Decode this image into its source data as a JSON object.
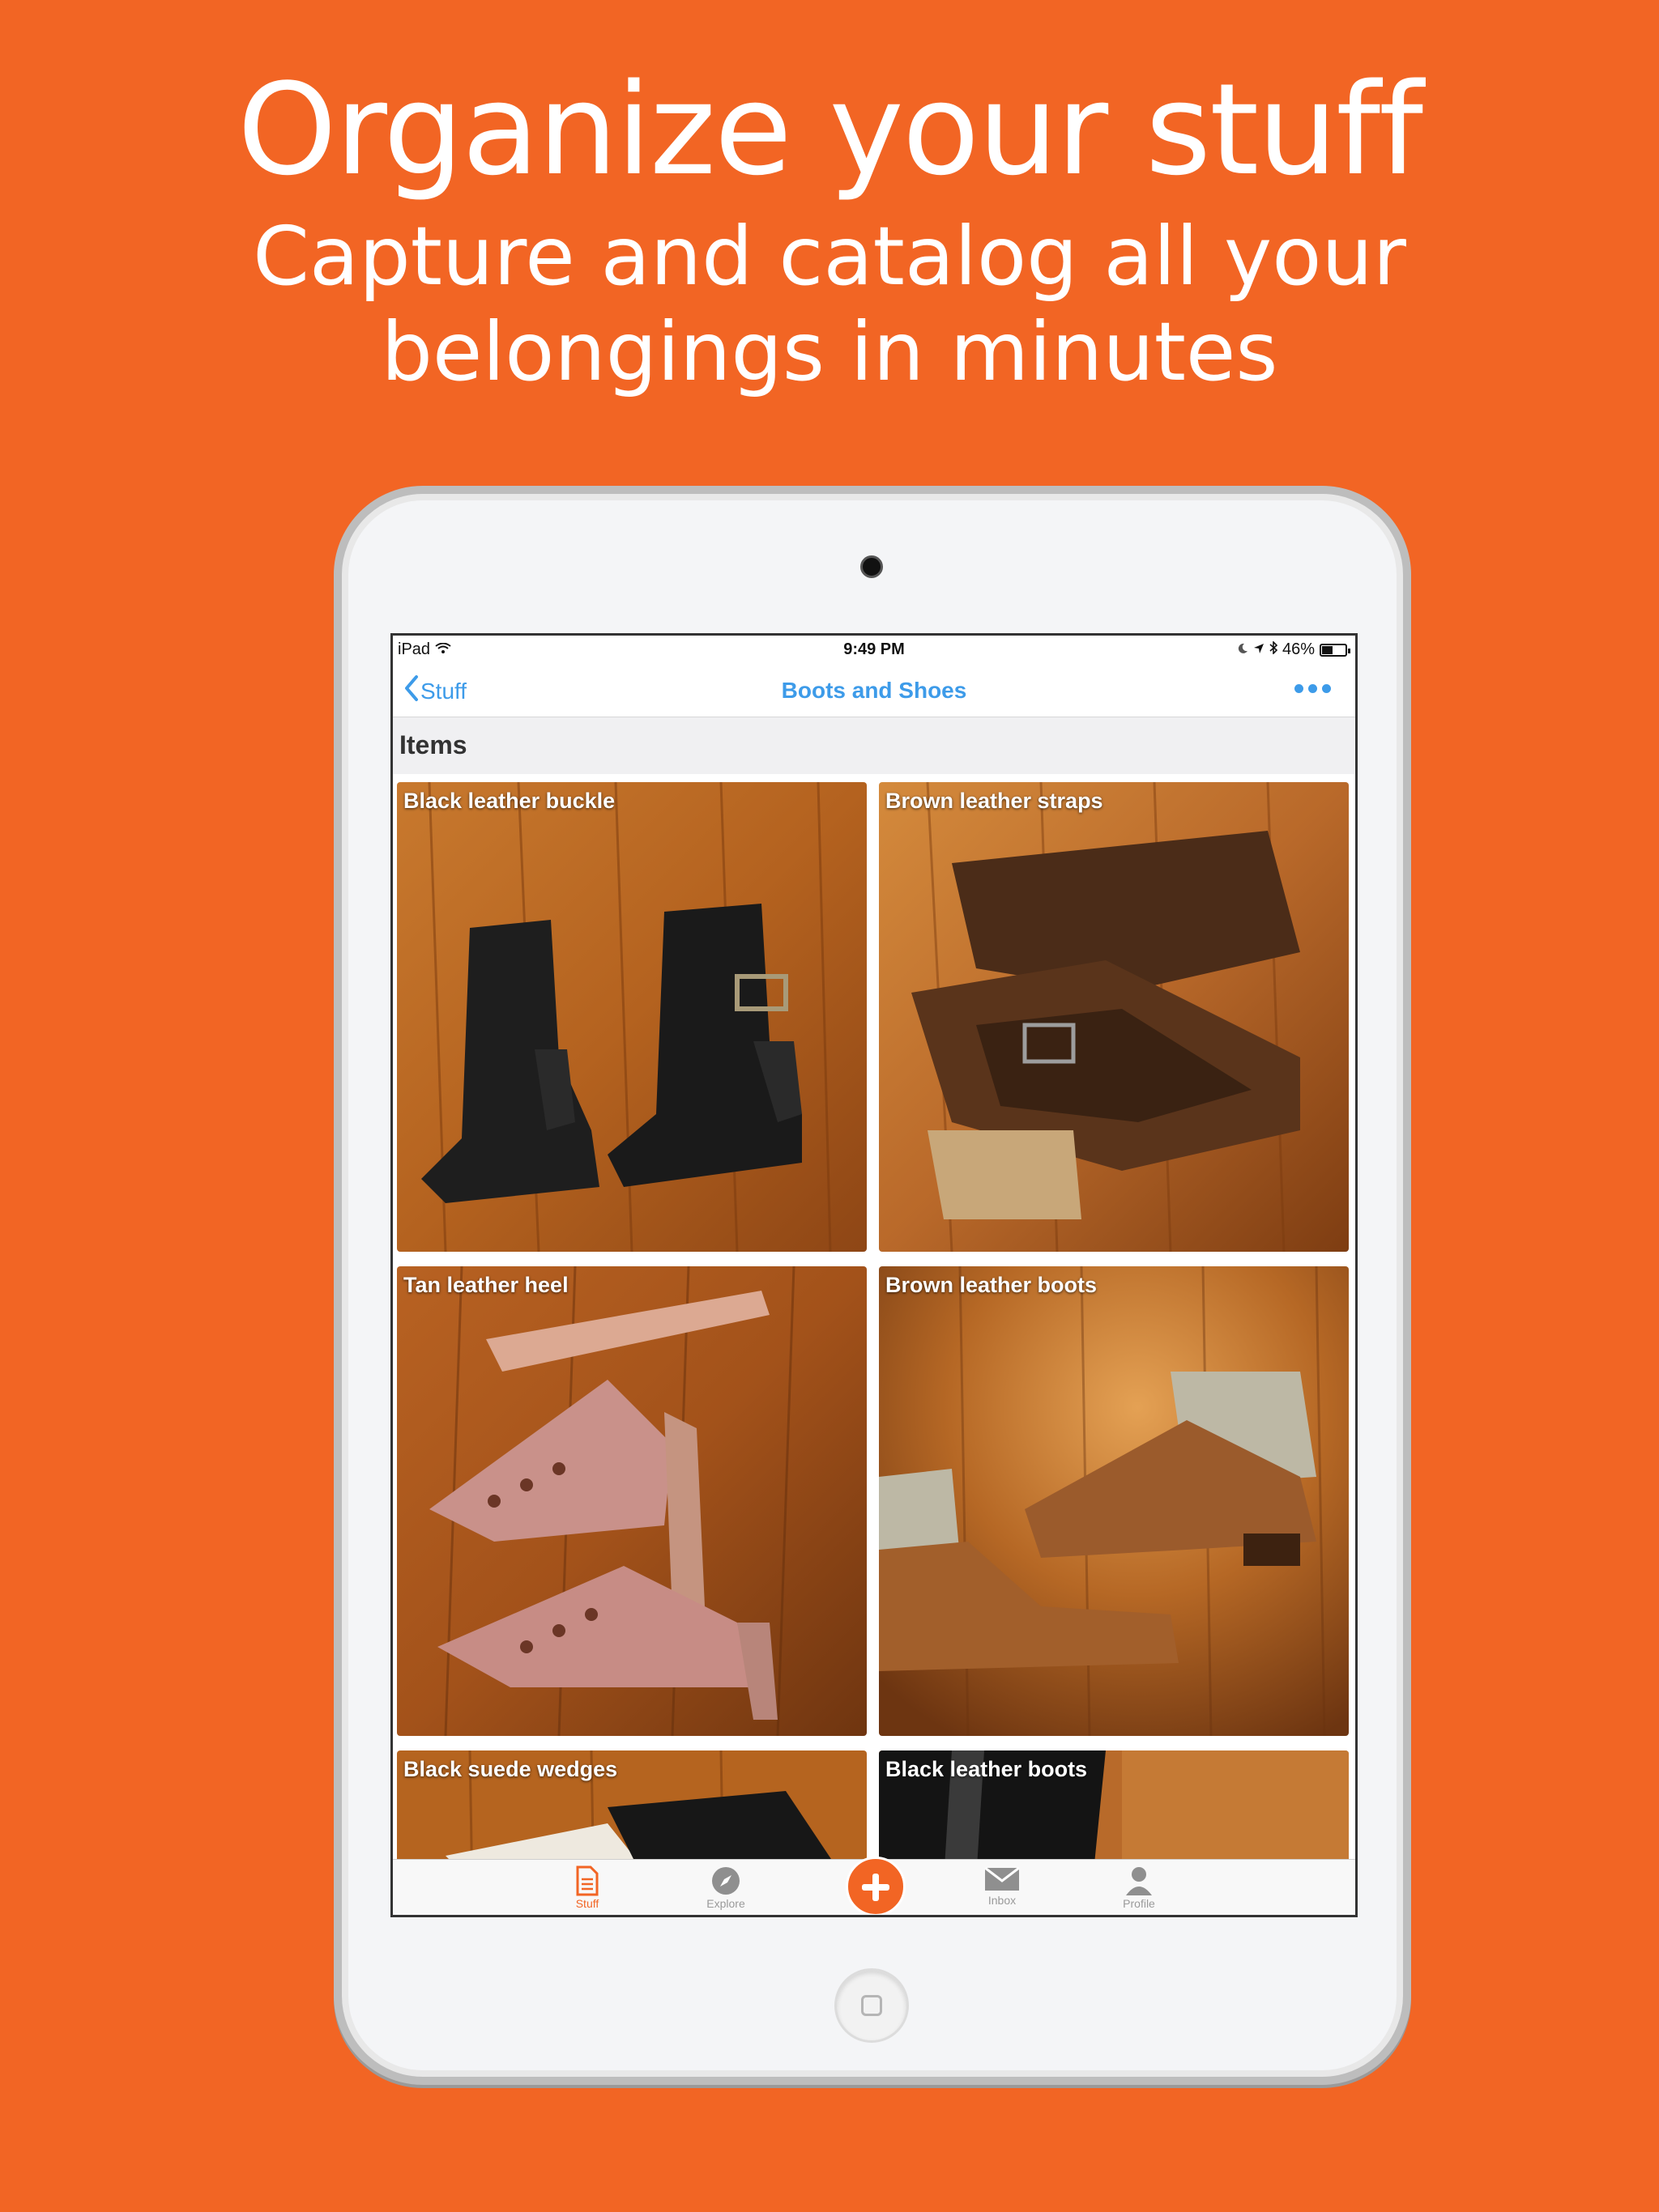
{
  "promo": {
    "headline": "Organize your stuff",
    "subline_1": "Capture and catalog all your",
    "subline_2": "belongings in minutes",
    "background_color": "#F26524"
  },
  "status_bar": {
    "device": "iPad",
    "time": "9:49 PM",
    "battery": "46%",
    "battery_level": 0.46
  },
  "nav": {
    "back_label": "Stuff",
    "title": "Boots and Shoes",
    "more_icon": "ellipsis-icon",
    "accent_color": "#3d9be9"
  },
  "section": {
    "title": "Items"
  },
  "items": [
    {
      "label": "Black leather buckle"
    },
    {
      "label": "Brown leather straps"
    },
    {
      "label": "Tan leather heel"
    },
    {
      "label": "Brown leather boots"
    },
    {
      "label": "Black suede wedges"
    },
    {
      "label": "Black leather boots"
    }
  ],
  "tabbar": {
    "tabs": [
      {
        "label": "Stuff",
        "icon": "document-icon",
        "active": true
      },
      {
        "label": "Explore",
        "icon": "compass-icon",
        "active": false
      },
      {
        "label": "",
        "icon": "plus-icon",
        "active": false
      },
      {
        "label": "Inbox",
        "icon": "envelope-icon",
        "active": false
      },
      {
        "label": "Profile",
        "icon": "person-icon",
        "active": false
      }
    ]
  }
}
